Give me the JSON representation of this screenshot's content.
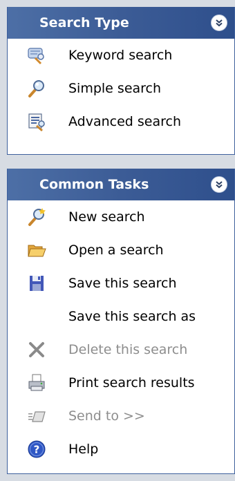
{
  "search_type": {
    "title": "Search Type",
    "items": [
      {
        "label": "Keyword search",
        "icon": "keyword-search-icon",
        "enabled": true
      },
      {
        "label": "Simple search",
        "icon": "magnifier-icon",
        "enabled": true
      },
      {
        "label": "Advanced search",
        "icon": "advanced-search-icon",
        "enabled": true
      }
    ]
  },
  "common_tasks": {
    "title": "Common Tasks",
    "items": [
      {
        "label": "New search",
        "icon": "new-search-icon",
        "enabled": true
      },
      {
        "label": "Open a search",
        "icon": "folder-open-icon",
        "enabled": true
      },
      {
        "label": "Save this search",
        "icon": "floppy-disk-icon",
        "enabled": true
      },
      {
        "label": "Save this search as",
        "icon": "none",
        "enabled": true
      },
      {
        "label": "Delete this search",
        "icon": "delete-x-icon",
        "enabled": false
      },
      {
        "label": "Print search results",
        "icon": "printer-icon",
        "enabled": true
      },
      {
        "label": "Send to >>",
        "icon": "send-to-icon",
        "enabled": false
      },
      {
        "label": "Help",
        "icon": "help-icon",
        "enabled": true
      }
    ]
  },
  "colors": {
    "header_bg": "#3c5c96",
    "header_text": "#ffffff",
    "panel_bg": "#ffffff",
    "page_bg": "#d7dce3",
    "disabled_text": "#8d8d8d"
  }
}
